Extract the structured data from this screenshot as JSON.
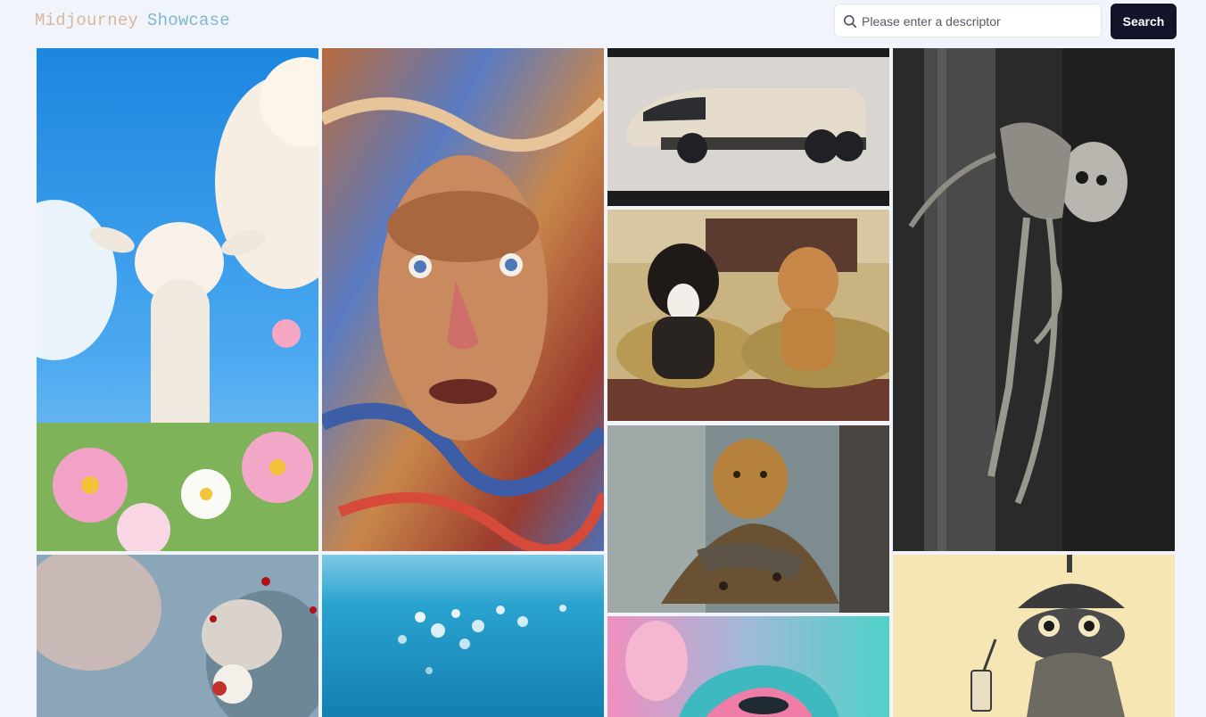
{
  "header": {
    "brand_word1": "Midjourney",
    "brand_word2": "Showcase",
    "search_placeholder": "Please enter a descriptor",
    "search_value": "",
    "search_button_label": "Search"
  },
  "gallery": {
    "tiles": [
      "llama-in-flowers-image",
      "marbled-face-portrait-image",
      "retro-futuristic-vehicle-image",
      "dogs-in-pickup-truck-image",
      "leopard-cat-warrior-image",
      "skeletal-creature-on-tree-image",
      "crowned-bird-image",
      "ocean-sparkle-image",
      "coral-neon-image",
      "sketch-creature-with-drink-image"
    ]
  },
  "colors": {
    "accent": "#13142a",
    "brand_word1": "#d8b79a",
    "brand_word2": "#7fb7cf",
    "page_background": "#f1f4fb"
  }
}
